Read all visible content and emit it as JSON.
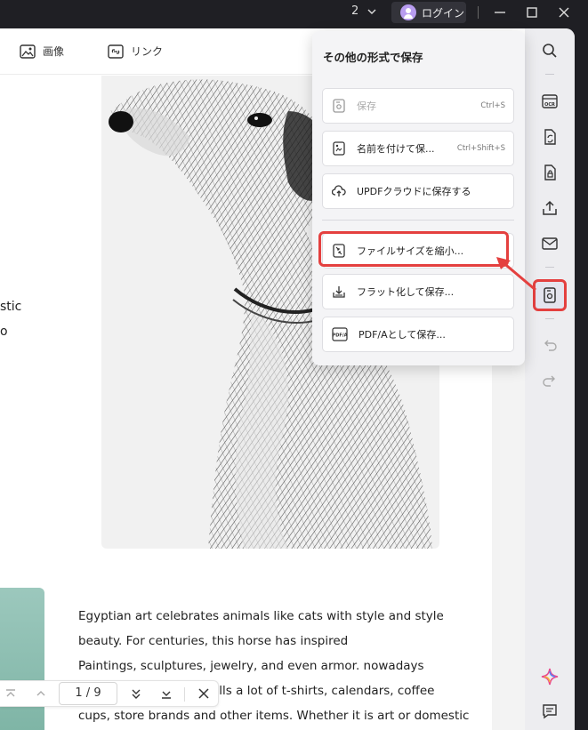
{
  "titlebar": {
    "page_count": "2",
    "login_label": "ログイン"
  },
  "toolbar": {
    "image_label": "画像",
    "link_label": "リンク"
  },
  "document": {
    "side_fragments": [
      "stic",
      "o"
    ],
    "body_lines": [
      "Egyptian art celebrates animals like cats with style and style",
      "beauty. For centuries, this horse has inspired",
      "Paintings, sculptures, jewelry, and even armor. nowadays",
      "ells a lot of t-shirts, calendars, coffee",
      "cups, store brands and other items. Whether it is art or domestic"
    ]
  },
  "findbar": {
    "page_indicator": "1 / 9"
  },
  "save_panel": {
    "title": "その他の形式で保存",
    "items": [
      {
        "label": "保存",
        "shortcut": "Ctrl+S",
        "disabled": true
      },
      {
        "label": "名前を付けて保...",
        "shortcut": "Ctrl+Shift+S"
      },
      {
        "label": "UPDFクラウドに保存する",
        "shortcut": ""
      },
      {
        "label": "ファイルサイズを縮小...",
        "shortcut": ""
      },
      {
        "label": "フラット化して保存...",
        "shortcut": ""
      },
      {
        "label": "PDF/Aとして保存...",
        "shortcut": ""
      }
    ]
  },
  "colors": {
    "highlight": "#e4403f",
    "titlebar_bg": "#1f1f24",
    "sidebar_bg": "#ededf0"
  },
  "icons": {
    "sidebar": [
      "search-icon",
      "ocr-icon",
      "convert-icon",
      "protect-icon",
      "share-icon",
      "mail-icon",
      "save-as-icon",
      "undo-icon",
      "redo-icon",
      "ai-icon",
      "comment-icon"
    ]
  }
}
